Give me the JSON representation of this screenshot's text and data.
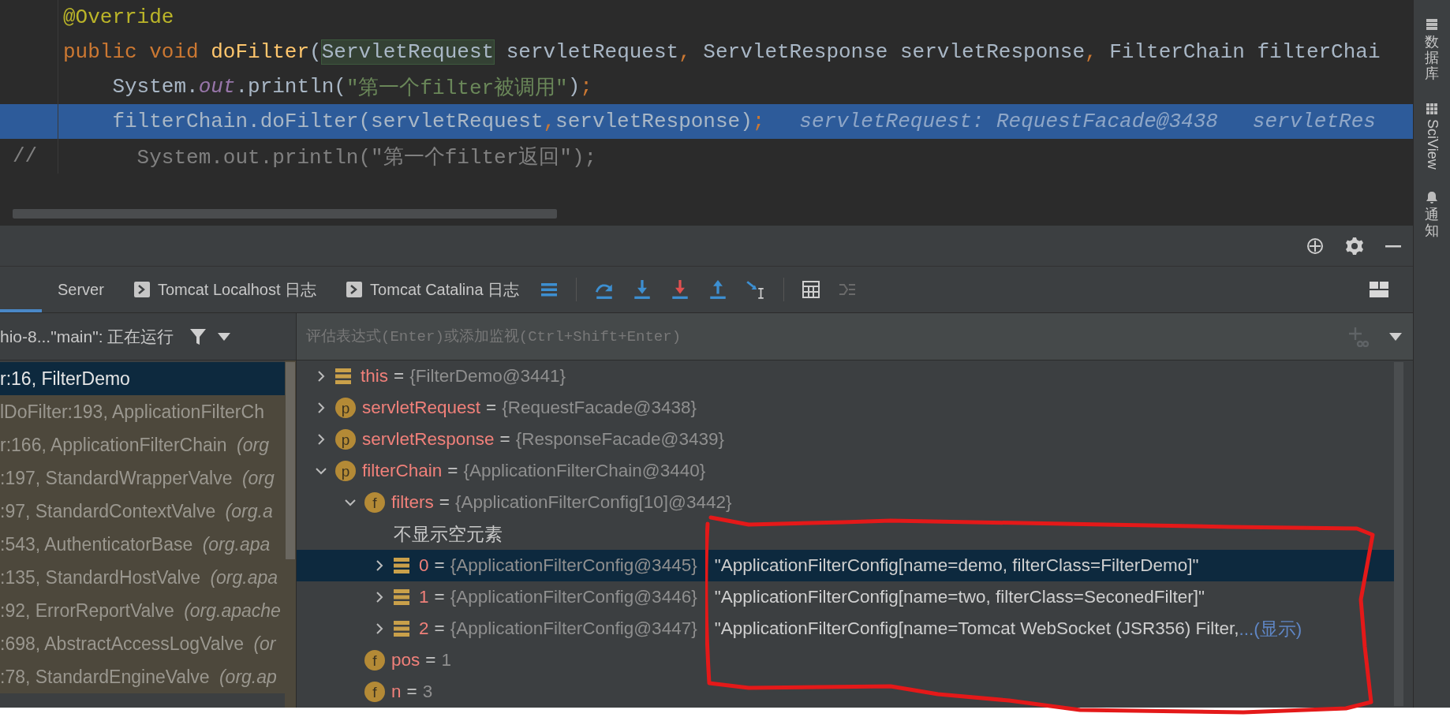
{
  "editor": {
    "lines": [
      {
        "execution": false,
        "tokens": [
          {
            "text": "@Override",
            "kind": "annotation"
          }
        ]
      },
      {
        "execution": false,
        "tokens": [
          {
            "text": "public void ",
            "kind": "keyword"
          },
          {
            "text": "doFilter",
            "kind": "method"
          },
          {
            "text": "(",
            "kind": "plain"
          },
          {
            "text": "ServletRequest",
            "kind": "type-highlight"
          },
          {
            "text": " servletRequest",
            "kind": "plain"
          },
          {
            "text": ",",
            "kind": "keyword"
          },
          {
            "text": " ServletResponse servletResponse",
            "kind": "plain"
          },
          {
            "text": ",",
            "kind": "keyword"
          },
          {
            "text": " FilterChain filterChai",
            "kind": "plain"
          }
        ]
      },
      {
        "execution": false,
        "tokens": [
          {
            "text": "    System.",
            "kind": "plain"
          },
          {
            "text": "out",
            "kind": "static"
          },
          {
            "text": ".println(",
            "kind": "plain"
          },
          {
            "text": "\"第一个filter被调用\"",
            "kind": "string"
          },
          {
            "text": ")",
            "kind": "plain"
          },
          {
            "text": ";",
            "kind": "keyword"
          }
        ]
      },
      {
        "execution": true,
        "tokens": [
          {
            "text": "    filterChain.doFilter(servletRequest",
            "kind": "plain"
          },
          {
            "text": ",",
            "kind": "keyword"
          },
          {
            "text": "servletResponse)",
            "kind": "plain"
          },
          {
            "text": ";",
            "kind": "keyword"
          },
          {
            "text": "servletRequest: RequestFacade@3438",
            "kind": "hint"
          },
          {
            "text": "servletRes",
            "kind": "hint"
          }
        ]
      },
      {
        "execution": false,
        "gutter_text": "//",
        "tokens": [
          {
            "text": "      System.out.println(\"第一个filter返回\");",
            "kind": "comment"
          }
        ]
      }
    ]
  },
  "tool_strip": {
    "buttons": [
      {
        "label": "数据库",
        "kind": "cjk"
      },
      {
        "label": "SciView",
        "kind": "latin"
      },
      {
        "label": "通知",
        "kind": "cjk"
      }
    ]
  },
  "debugger": {
    "partial_tab": {
      "selected": true
    },
    "tabs": [
      {
        "label": "Server",
        "kind": "plain",
        "selected": false
      },
      {
        "label": "Tomcat Localhost 日志",
        "kind": "console",
        "selected": false
      },
      {
        "label": "Tomcat Catalina 日志",
        "kind": "console",
        "selected": false
      }
    ],
    "thread_selector": {
      "text": "hio-8...\"main\": 正在运行"
    },
    "evaluate_field": {
      "placeholder": "评估表达式(Enter)或添加监视(Ctrl+Shift+Enter)"
    },
    "frames": [
      {
        "text": "r:16, FilterDemo",
        "selected": true,
        "library": false
      },
      {
        "text": "lDoFilter:193, ApplicationFilterCh",
        "selected": false,
        "library": true
      },
      {
        "text": "r:166, ApplicationFilterChain *(org*",
        "selected": false,
        "library": true
      },
      {
        "text": ":197, StandardWrapperValve *(org*",
        "selected": false,
        "library": true
      },
      {
        "text": ":97, StandardContextValve *(org.a*",
        "selected": false,
        "library": true
      },
      {
        "text": ":543, AuthenticatorBase *(org.apa*",
        "selected": false,
        "library": true
      },
      {
        "text": ":135, StandardHostValve *(org.apa*",
        "selected": false,
        "library": true
      },
      {
        "text": ":92, ErrorReportValve *(org.apache*",
        "selected": false,
        "library": true
      },
      {
        "text": ":698, AbstractAccessLogValve *(or*",
        "selected": false,
        "library": true
      },
      {
        "text": ":78, StandardEngineValve *(org.ap*",
        "selected": false,
        "library": true
      }
    ],
    "variables": [
      {
        "kind": "object",
        "name": "this",
        "separator": "=",
        "value": "{FilterDemo@3441}",
        "expanded": false,
        "selected": false
      },
      {
        "kind": "parameter",
        "badge": "p",
        "name": "servletRequest",
        "separator": "=",
        "value": "{RequestFacade@3438}",
        "expanded": false,
        "selected": false
      },
      {
        "kind": "parameter",
        "badge": "p",
        "name": "servletResponse",
        "separator": "=",
        "value": "{ResponseFacade@3439}",
        "expanded": false,
        "selected": false
      },
      {
        "kind": "parameter",
        "badge": "p",
        "name": "filterChain",
        "separator": "=",
        "value": "{ApplicationFilterChain@3440}",
        "expanded": true,
        "selected": false,
        "children": [
          {
            "kind": "field",
            "badge": "f",
            "name": "filters",
            "separator": "=",
            "value": "{ApplicationFilterConfig[10]@3442}",
            "expanded": true,
            "selected": false,
            "children": [
              {
                "kind": "note",
                "name": "不显示空元素",
                "selected": false
              },
              {
                "kind": "element",
                "name": "0",
                "separator": "=",
                "value": "{ApplicationFilterConfig@3445}",
                "string_value": "\"ApplicationFilterConfig[name=demo, filterClass=FilterDemo]\"",
                "expanded": false,
                "selected": true
              },
              {
                "kind": "element",
                "name": "1",
                "separator": "=",
                "value": "{ApplicationFilterConfig@3446}",
                "string_value": "\"ApplicationFilterConfig[name=two, filterClass=SeconedFilter]\"",
                "expanded": false,
                "selected": false
              },
              {
                "kind": "element",
                "name": "2",
                "separator": "=",
                "value": "{ApplicationFilterConfig@3447}",
                "string_value": "\"ApplicationFilterConfig[name=Tomcat WebSocket (JSR356) Filter, ",
                "link": "...(显示)",
                "expanded": false,
                "selected": false
              }
            ]
          },
          {
            "kind": "field",
            "badge": "f",
            "name": "pos",
            "separator": "=",
            "value": "1",
            "selected": false
          },
          {
            "kind": "field",
            "badge": "f",
            "name": "n",
            "separator": "=",
            "value": "3",
            "selected": false
          }
        ]
      }
    ]
  }
}
